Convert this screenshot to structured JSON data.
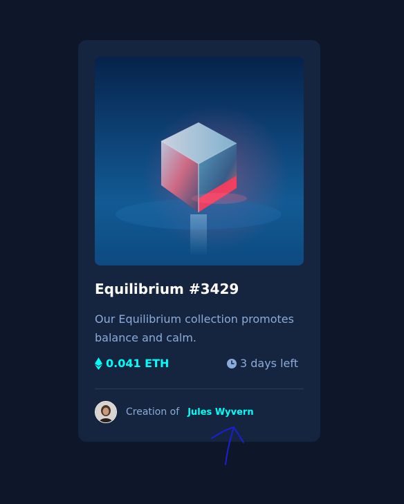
{
  "nft": {
    "title": "Equilibrium #3429",
    "description": "Our Equilibrium collection promotes balance and calm.",
    "price": "0.041 ETH",
    "time_left": "3 days left",
    "creator_label": "Creation of",
    "creator_name": "Jules Wyvern"
  },
  "icons": {
    "price": "ethereum-icon",
    "time": "clock-icon",
    "annotation": "hand-drawn-arrow-icon"
  },
  "colors": {
    "page_background": "#0e1729",
    "card_background": "#15253f",
    "accent_cyan": "#00fff8",
    "soft_blue": "#8bacd9",
    "divider": "#2e405a",
    "annotation_ink": "#1a1fd6"
  }
}
